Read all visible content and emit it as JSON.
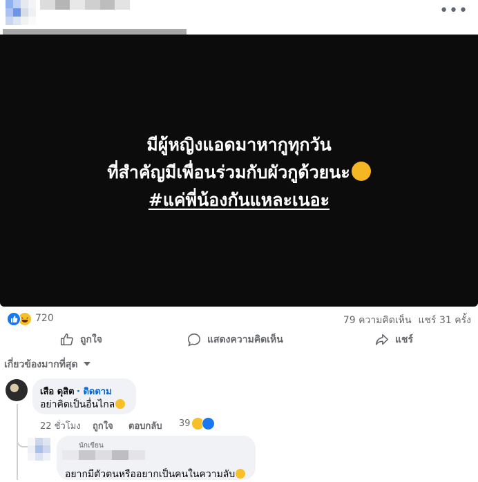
{
  "post": {
    "media_lines": [
      "มีผู้หญิงแอดมาหากูทุกวัน",
      "ที่สำคัญมีเพื่อนร่วมกับผัวกูด้วยนะ",
      "#แค่พี่น้องกันแหละเนอะ"
    ],
    "media_emoji": "thinking-face-emoji",
    "more_label": "•••"
  },
  "stats": {
    "reaction_count": "720",
    "comments": "79 ความคิดเห็น",
    "shares": "แชร์ 31 ครั้ง"
  },
  "actions": {
    "like": "ถูกใจ",
    "comment": "แสดงความคิดเห็น",
    "share": "แชร์"
  },
  "filter": {
    "label": "เกี่ยวข้องมากที่สุด"
  },
  "comments": [
    {
      "author": "เสือ ดุสิต",
      "follow": "· ติดตาม",
      "text": "อย่าคิดเป็นอื่นไกล",
      "time": "22 ชั่วโมง",
      "like": "ถูกใจ",
      "reply": "ตอบกลับ",
      "reaction_count": "39"
    },
    {
      "badge": "นักเขียน",
      "text": "อยากมีตัวตนหรืออยากเป็นคนในความลับ"
    }
  ],
  "colors": {
    "brand_blue": "#1877f2",
    "link_blue": "#0064d1",
    "muted": "#65676b",
    "bubble": "#f0f2f5",
    "media_bg": "#0c0c0c"
  }
}
